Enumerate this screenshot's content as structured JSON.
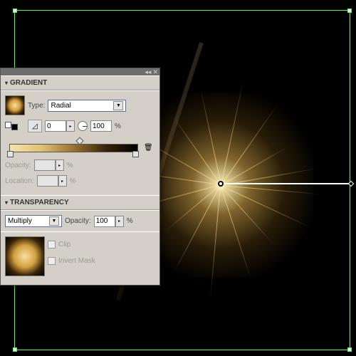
{
  "gradient": {
    "title": "GRADIENT",
    "type_label": "Type:",
    "type_value": "Radial",
    "angle_value": "0",
    "aspect_value": "100",
    "aspect_unit": "%",
    "opacity_label": "Opacity:",
    "opacity_unit": "%",
    "location_label": "Location:",
    "location_unit": "%",
    "stops_pct": [
      0,
      100
    ],
    "midpoint_pct": 50
  },
  "transparency": {
    "title": "TRANSPARENCY",
    "blend_value": "Multiply",
    "opacity_label": "Opacity:",
    "opacity_value": "100",
    "opacity_unit": "%",
    "clip_label": "Clip",
    "invert_label": "Invert Mask"
  }
}
